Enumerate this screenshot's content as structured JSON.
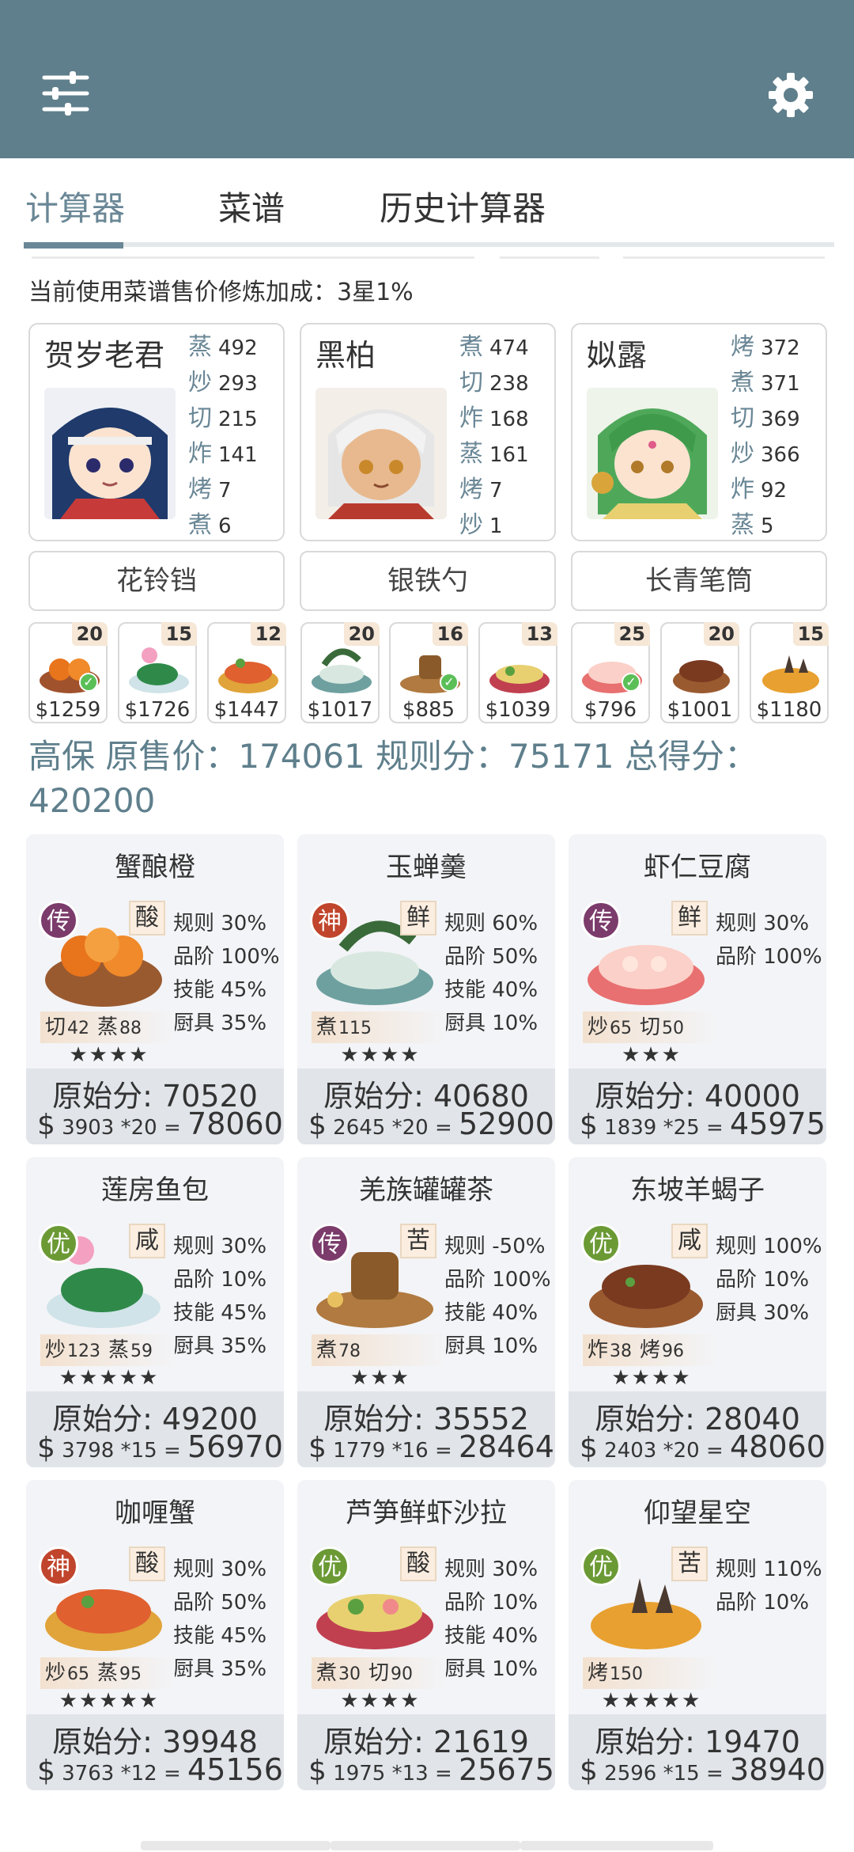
{
  "tabs": [
    "计算器",
    "菜谱",
    "历史计算器"
  ],
  "info_text": "当前使用菜谱售价修炼加成：3星1%",
  "chefs": [
    {
      "name": "贺岁老君",
      "skills": [
        {
          "k": "蒸",
          "v": "492"
        },
        {
          "k": "炒",
          "v": "293"
        },
        {
          "k": "切",
          "v": "215"
        },
        {
          "k": "炸",
          "v": "141"
        },
        {
          "k": "烤",
          "v": "7"
        },
        {
          "k": "煮",
          "v": "6"
        }
      ]
    },
    {
      "name": "黑柏",
      "skills": [
        {
          "k": "煮",
          "v": "474"
        },
        {
          "k": "切",
          "v": "238"
        },
        {
          "k": "炸",
          "v": "168"
        },
        {
          "k": "蒸",
          "v": "161"
        },
        {
          "k": "烤",
          "v": "7"
        },
        {
          "k": "炒",
          "v": "1"
        }
      ]
    },
    {
      "name": "姒露",
      "skills": [
        {
          "k": "烤",
          "v": "372"
        },
        {
          "k": "煮",
          "v": "371"
        },
        {
          "k": "切",
          "v": "369"
        },
        {
          "k": "炒",
          "v": "366"
        },
        {
          "k": "炸",
          "v": "92"
        },
        {
          "k": "蒸",
          "v": "5"
        }
      ]
    }
  ],
  "equipment": [
    "花铃铛",
    "银铁勺",
    "长青笔筒"
  ],
  "ingredients": [
    {
      "count": "20",
      "price": "$1259",
      "check": true
    },
    {
      "count": "15",
      "price": "$1726",
      "check": false
    },
    {
      "count": "12",
      "price": "$1447",
      "check": false
    },
    {
      "count": "20",
      "price": "$1017",
      "check": false
    },
    {
      "count": "16",
      "price": "$885",
      "check": true
    },
    {
      "count": "13",
      "price": "$1039",
      "check": false
    },
    {
      "count": "25",
      "price": "$796",
      "check": true
    },
    {
      "count": "20",
      "price": "$1001",
      "check": false
    },
    {
      "count": "15",
      "price": "$1180",
      "check": false
    }
  ],
  "summary": "高保 原售价：174061 规则分：75171 总得分：420200",
  "dishes": [
    {
      "name": "蟹酿橙",
      "rarity": "传",
      "rarity_color": "#7b3b6b",
      "cond": "酸",
      "mods": [
        "规则 30%",
        "品阶 100%",
        "技能 45%",
        "厨具 35%"
      ],
      "req": [
        {
          "k": "切",
          "v": "42"
        },
        {
          "k": "蒸",
          "v": "88"
        }
      ],
      "stars": "★★★★",
      "orig": "原始分: 70520",
      "price": "3903",
      "mult": "*20",
      "total": "78060"
    },
    {
      "name": "玉蝉羹",
      "rarity": "神",
      "rarity_color": "#c0452c",
      "cond": "鲜",
      "mods": [
        "规则 60%",
        "品阶 50%",
        "技能 40%",
        "厨具 10%"
      ],
      "req": [
        {
          "k": "煮",
          "v": "115"
        }
      ],
      "stars": "★★★★",
      "orig": "原始分: 40680",
      "price": "2645",
      "mult": "*20",
      "total": "52900"
    },
    {
      "name": "虾仁豆腐",
      "rarity": "传",
      "rarity_color": "#7b3b6b",
      "cond": "鲜",
      "mods": [
        "规则 30%",
        "品阶 100%"
      ],
      "req": [
        {
          "k": "炒",
          "v": "65"
        },
        {
          "k": "切",
          "v": "50"
        }
      ],
      "stars": "★★★",
      "orig": "原始分: 40000",
      "price": "1839",
      "mult": "*25",
      "total": "45975"
    },
    {
      "name": "莲房鱼包",
      "rarity": "优",
      "rarity_color": "#6b9a35",
      "cond": "咸",
      "mods": [
        "规则 30%",
        "品阶 10%",
        "技能 45%",
        "厨具 35%"
      ],
      "req": [
        {
          "k": "炒",
          "v": "123"
        },
        {
          "k": "蒸",
          "v": "59"
        }
      ],
      "stars": "★★★★★",
      "orig": "原始分: 49200",
      "price": "3798",
      "mult": "*15",
      "total": "56970"
    },
    {
      "name": "羌族罐罐茶",
      "rarity": "传",
      "rarity_color": "#7b3b6b",
      "cond": "苦",
      "mods": [
        "规则 -50%",
        "品阶 100%",
        "技能 40%",
        "厨具 10%"
      ],
      "req": [
        {
          "k": "煮",
          "v": "78"
        }
      ],
      "stars": "★★★",
      "orig": "原始分: 35552",
      "price": "1779",
      "mult": "*16",
      "total": "28464"
    },
    {
      "name": "东坡羊蝎子",
      "rarity": "优",
      "rarity_color": "#6b9a35",
      "cond": "咸",
      "mods": [
        "规则 100%",
        "品阶 10%",
        "厨具 30%"
      ],
      "req": [
        {
          "k": "炸",
          "v": "38"
        },
        {
          "k": "烤",
          "v": "96"
        }
      ],
      "stars": "★★★★",
      "orig": "原始分: 28040",
      "price": "2403",
      "mult": "*20",
      "total": "48060"
    },
    {
      "name": "咖喱蟹",
      "rarity": "神",
      "rarity_color": "#c0452c",
      "cond": "酸",
      "mods": [
        "规则 30%",
        "品阶 50%",
        "技能 45%",
        "厨具 35%"
      ],
      "req": [
        {
          "k": "炒",
          "v": "65"
        },
        {
          "k": "蒸",
          "v": "95"
        }
      ],
      "stars": "★★★★★",
      "orig": "原始分: 39948",
      "price": "3763",
      "mult": "*12",
      "total": "45156"
    },
    {
      "name": "芦笋鲜虾沙拉",
      "rarity": "优",
      "rarity_color": "#6b9a35",
      "cond": "酸",
      "mods": [
        "规则 30%",
        "品阶 10%",
        "技能 40%",
        "厨具 10%"
      ],
      "req": [
        {
          "k": "煮",
          "v": "30"
        },
        {
          "k": "切",
          "v": "90"
        }
      ],
      "stars": "★★★★",
      "orig": "原始分: 21619",
      "price": "1975",
      "mult": "*13",
      "total": "25675"
    },
    {
      "name": "仰望星空",
      "rarity": "优",
      "rarity_color": "#6b9a35",
      "cond": "苦",
      "mods": [
        "规则 110%",
        "品阶 10%"
      ],
      "req": [
        {
          "k": "烤",
          "v": "150"
        }
      ],
      "stars": "★★★★★",
      "orig": "原始分: 19470",
      "price": "2596",
      "mult": "*15",
      "total": "38940"
    }
  ],
  "colors": {
    "appbar": "#5f7f8c",
    "accent": "#6a8796"
  },
  "icons": {
    "menu": "sliders-icon",
    "settings": "gear-icon"
  }
}
